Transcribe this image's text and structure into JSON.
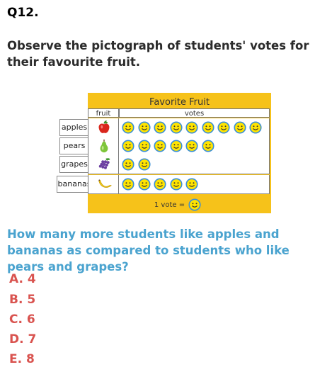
{
  "question_number": "Q12.",
  "prompt": "Observe the pictograph of students' votes for their favourite fruit.",
  "pictograph": {
    "title": "Favorite Fruit",
    "col_fruit": "fruit",
    "col_votes": "votes",
    "rows": [
      {
        "label": "apples",
        "icon": "apple-icon",
        "votes": 9
      },
      {
        "label": "pears",
        "icon": "pear-icon",
        "votes": 6
      },
      {
        "label": "grapes",
        "icon": "grapes-icon",
        "votes": 2
      },
      {
        "label": "bananas",
        "icon": "banana-icon",
        "votes": 5
      }
    ],
    "key_text": "1 vote =",
    "colors": {
      "panel": "#f6c21a",
      "smiley": "#ffe400"
    }
  },
  "question": "How many more students like apples and bananas as compared to students who like pears and grapes?",
  "options": [
    "A. 4",
    "B. 5",
    "C. 6",
    "D. 7",
    "E. 8"
  ]
}
